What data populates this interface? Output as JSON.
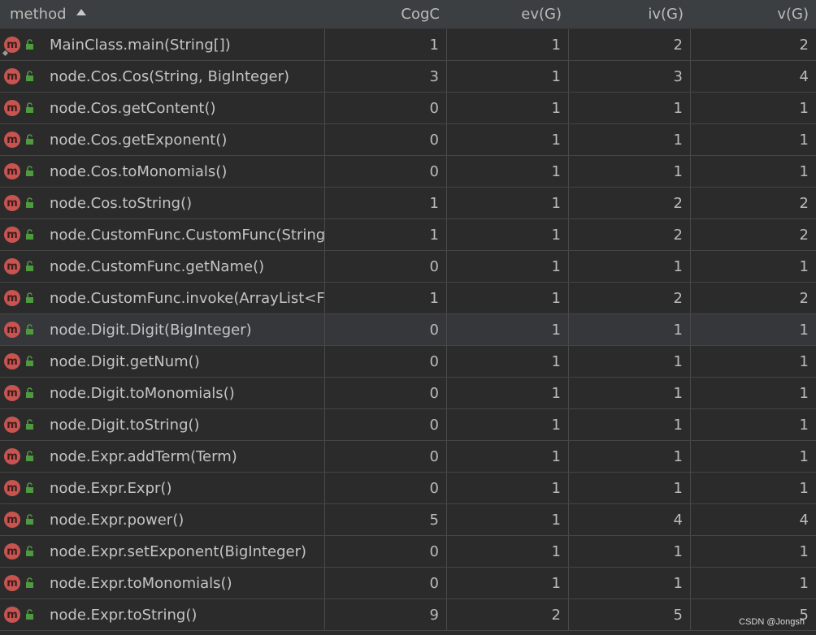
{
  "columns": {
    "method": "method",
    "cogc": "CogC",
    "ev": "ev(G)",
    "iv": "iv(G)",
    "v": "v(G)"
  },
  "icons": {
    "method_icon": "m",
    "method_icon_color": "#c75450",
    "lock_icon_color": "#4e9a3f"
  },
  "rows": [
    {
      "method": "MainClass.main(String[])",
      "cogc": "1",
      "ev": "1",
      "iv": "2",
      "v": "2"
    },
    {
      "method": "node.Cos.Cos(String, BigInteger)",
      "cogc": "3",
      "ev": "1",
      "iv": "3",
      "v": "4"
    },
    {
      "method": "node.Cos.getContent()",
      "cogc": "0",
      "ev": "1",
      "iv": "1",
      "v": "1"
    },
    {
      "method": "node.Cos.getExponent()",
      "cogc": "0",
      "ev": "1",
      "iv": "1",
      "v": "1"
    },
    {
      "method": "node.Cos.toMonomials()",
      "cogc": "0",
      "ev": "1",
      "iv": "1",
      "v": "1"
    },
    {
      "method": "node.Cos.toString()",
      "cogc": "1",
      "ev": "1",
      "iv": "2",
      "v": "2"
    },
    {
      "method": "node.CustomFunc.CustomFunc(String",
      "cogc": "1",
      "ev": "1",
      "iv": "2",
      "v": "2"
    },
    {
      "method": "node.CustomFunc.getName()",
      "cogc": "0",
      "ev": "1",
      "iv": "1",
      "v": "1"
    },
    {
      "method": "node.CustomFunc.invoke(ArrayList<F",
      "cogc": "1",
      "ev": "1",
      "iv": "2",
      "v": "2"
    },
    {
      "method": "node.Digit.Digit(BigInteger)",
      "cogc": "0",
      "ev": "1",
      "iv": "1",
      "v": "1"
    },
    {
      "method": "node.Digit.getNum()",
      "cogc": "0",
      "ev": "1",
      "iv": "1",
      "v": "1"
    },
    {
      "method": "node.Digit.toMonomials()",
      "cogc": "0",
      "ev": "1",
      "iv": "1",
      "v": "1"
    },
    {
      "method": "node.Digit.toString()",
      "cogc": "0",
      "ev": "1",
      "iv": "1",
      "v": "1"
    },
    {
      "method": "node.Expr.addTerm(Term)",
      "cogc": "0",
      "ev": "1",
      "iv": "1",
      "v": "1"
    },
    {
      "method": "node.Expr.Expr()",
      "cogc": "0",
      "ev": "1",
      "iv": "1",
      "v": "1"
    },
    {
      "method": "node.Expr.power()",
      "cogc": "5",
      "ev": "1",
      "iv": "4",
      "v": "4"
    },
    {
      "method": "node.Expr.setExponent(BigInteger)",
      "cogc": "0",
      "ev": "1",
      "iv": "1",
      "v": "1"
    },
    {
      "method": "node.Expr.toMonomials()",
      "cogc": "0",
      "ev": "1",
      "iv": "1",
      "v": "1"
    },
    {
      "method": "node.Expr.toString()",
      "cogc": "9",
      "ev": "2",
      "iv": "5",
      "v": "5"
    }
  ],
  "selected_row": 9,
  "watermark": "CSDN @Jongsh"
}
